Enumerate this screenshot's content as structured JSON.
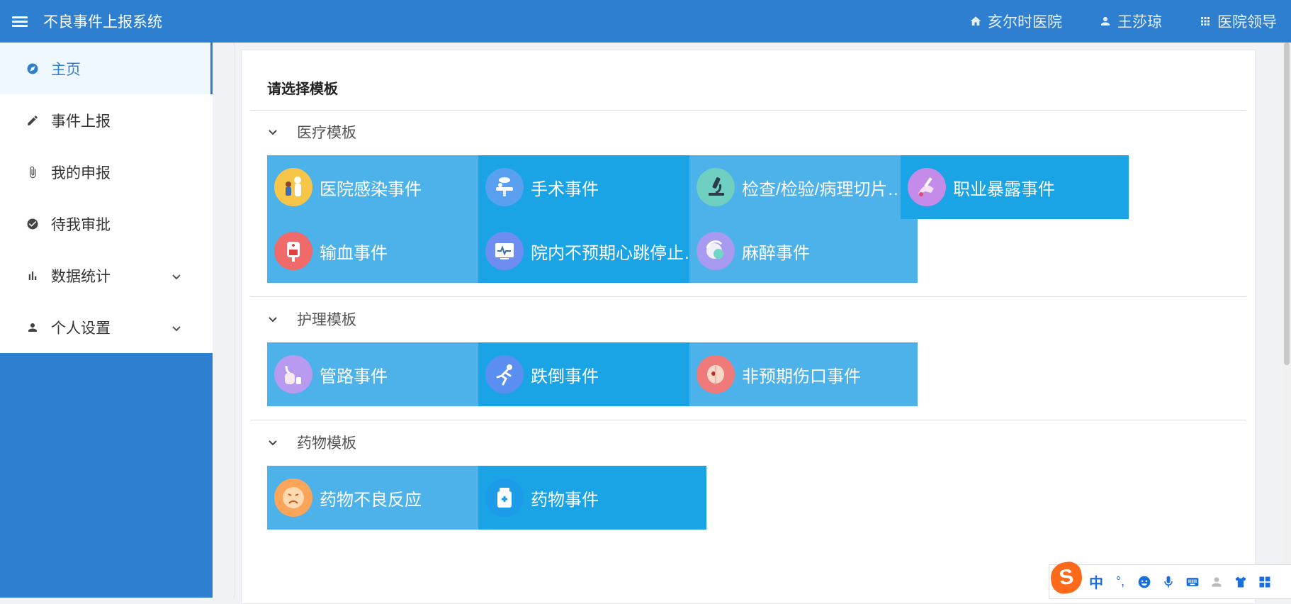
{
  "header": {
    "title": "不良事件上报系统",
    "hospital": "亥尔时医院",
    "user": "王莎琼",
    "role": "医院领导"
  },
  "sidebar": {
    "items": [
      {
        "label": "主页",
        "icon": "home-circle-icon",
        "active": true
      },
      {
        "label": "事件上报",
        "icon": "pencil-icon"
      },
      {
        "label": "我的申报",
        "icon": "paperclip-icon"
      },
      {
        "label": "待我审批",
        "icon": "check-circle-icon"
      },
      {
        "label": "数据统计",
        "icon": "bar-chart-icon",
        "expandable": true
      },
      {
        "label": "个人设置",
        "icon": "person-icon",
        "expandable": true
      }
    ]
  },
  "main": {
    "title": "请选择模板",
    "sections": [
      {
        "label": "医疗模板",
        "tiles": [
          "医院感染事件",
          "手术事件",
          "检查/检验/病理切片…",
          "职业暴露事件",
          "输血事件",
          "院内不预期心跳停止…",
          "麻醉事件"
        ]
      },
      {
        "label": "护理模板",
        "tiles": [
          "管路事件",
          "跌倒事件",
          "非预期伤口事件"
        ]
      },
      {
        "label": "药物模板",
        "tiles": [
          "药物不良反应",
          "药物事件"
        ]
      }
    ]
  },
  "ime": {
    "logo": "S",
    "mode": "中",
    "punct": "°,"
  },
  "colors": {
    "brand": "#2f7fd0",
    "tile_light": "#4db1ea",
    "tile_dark": "#1aa4e5"
  }
}
